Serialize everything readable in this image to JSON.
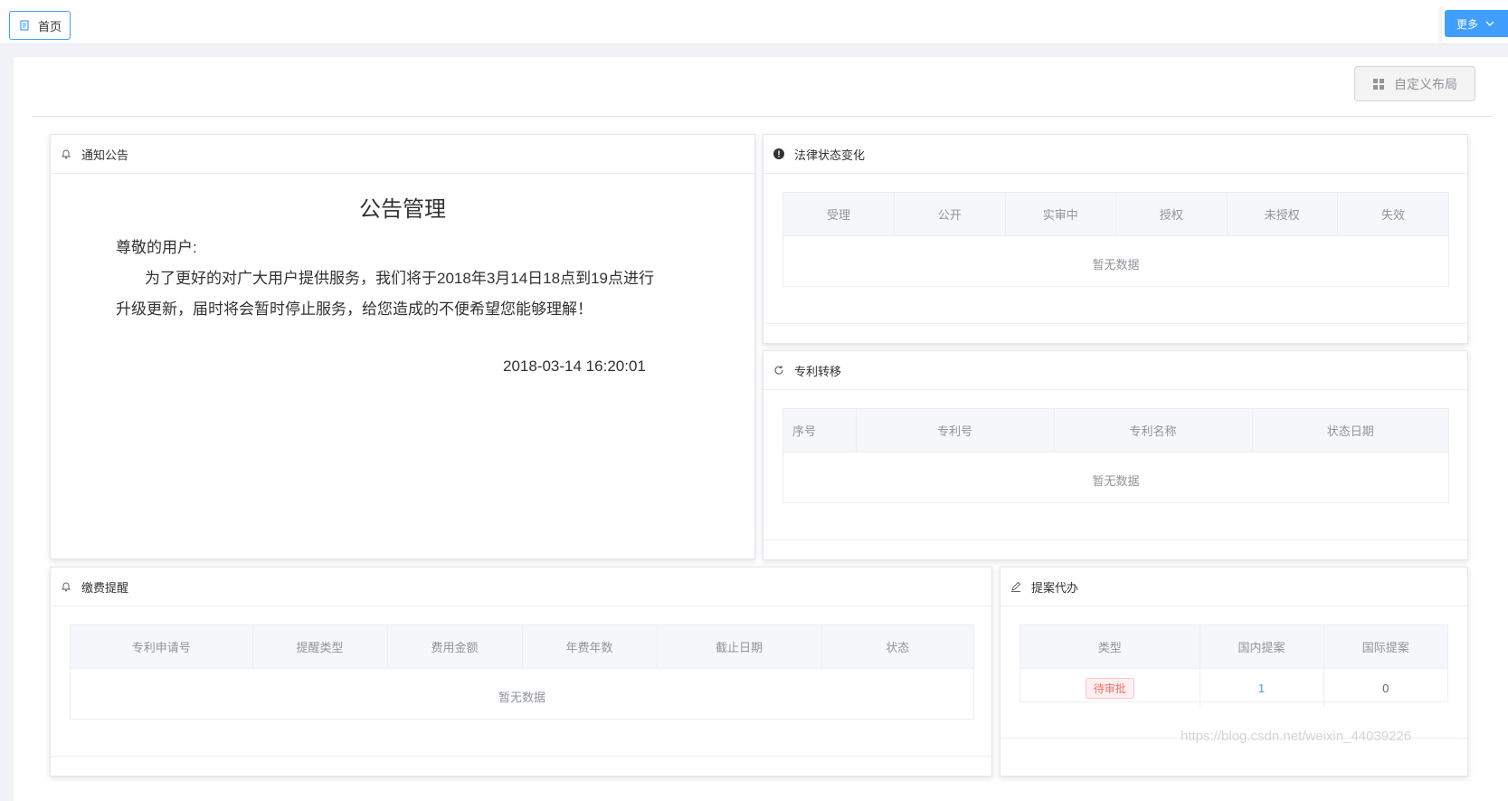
{
  "topbar": {
    "home_tab_label": "首页",
    "more_button_label": "更多"
  },
  "toolbar": {
    "custom_layout_label": "自定义布局"
  },
  "notice_card": {
    "header": "通知公告",
    "title": "公告管理",
    "greeting": "尊敬的用户:",
    "body": "为了更好的对广大用户提供服务，我们将于2018年3月14日18点到19点进行升级更新，届时将会暂时停止服务，给您造成的不便希望您能够理解！",
    "date": "2018-03-14 16:20:01"
  },
  "legal_card": {
    "header": "法律状态变化",
    "columns": [
      "受理",
      "公开",
      "实审中",
      "授权",
      "未授权",
      "失效"
    ],
    "empty_text": "暂无数据"
  },
  "transfer_card": {
    "header": "专利转移",
    "columns": [
      "序号",
      "专利号",
      "专利名称",
      "状态日期"
    ],
    "empty_text": "暂无数据"
  },
  "fee_card": {
    "header": "缴费提醒",
    "columns": [
      "专利申请号",
      "提醒类型",
      "费用金额",
      "年费年数",
      "截止日期",
      "状态"
    ],
    "empty_text": "暂无数据"
  },
  "proposal_card": {
    "header": "提案代办",
    "columns": [
      "类型",
      "国内提案",
      "国际提案"
    ],
    "row": {
      "type_tag": "待审批",
      "domestic": "1",
      "international": "0"
    }
  },
  "watermark": "https://blog.csdn.net/weixin_44039226",
  "colors": {
    "primary": "#409eff",
    "danger": "#f56c6c"
  }
}
